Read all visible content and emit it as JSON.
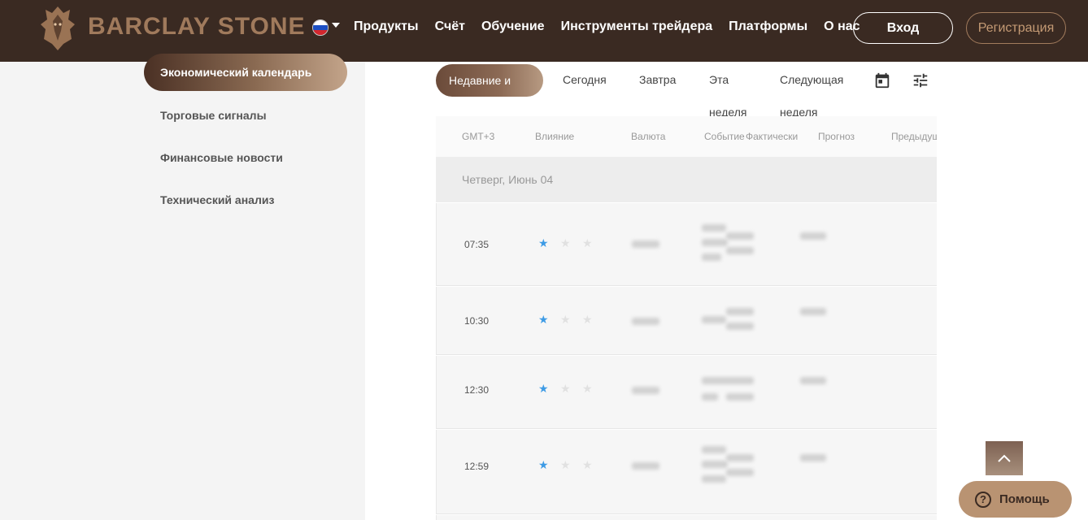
{
  "header": {
    "brand": "BARCLAY STONE",
    "language_icon": "ru-flag-icon",
    "nav": [
      "Продукты",
      "Счёт",
      "Обучение",
      "Инструменты трейдера",
      "Платформы",
      "О нас"
    ],
    "login_label": "Вход",
    "register_label": "Регистрация"
  },
  "sidebar": {
    "active_item": "Экономический календарь",
    "items": [
      "Торговые сигналы",
      "Финансовые новости",
      "Технический анализ"
    ]
  },
  "filters": {
    "active": "Недавние и",
    "tabs": [
      "Сегодня",
      "Завтра"
    ],
    "this_week": [
      "Эта",
      "неделя"
    ],
    "next_week": [
      "Следующая",
      "неделя"
    ],
    "calendar_icon": "calendar-icon",
    "settings_icon": "tune-icon"
  },
  "table": {
    "headers": [
      "GMT+3",
      "Влияние",
      "Валюта",
      "Событие",
      "Фактически",
      "Прогноз",
      "Предыдущ"
    ],
    "day_label": "Четверг, Июнь 04",
    "rows": [
      {
        "time": "07:35",
        "impact": 1
      },
      {
        "time": "10:30",
        "impact": 1
      },
      {
        "time": "12:30",
        "impact": 1
      },
      {
        "time": "12:59",
        "impact": 1
      }
    ]
  },
  "floating": {
    "scroll_top_icon": "chevron-up-icon",
    "help_label": "Помощь",
    "help_icon": "question-icon"
  },
  "colors": {
    "header_bg": "#3a2a22",
    "accent": "#a07a5c",
    "star_active": "#3d9be5"
  }
}
